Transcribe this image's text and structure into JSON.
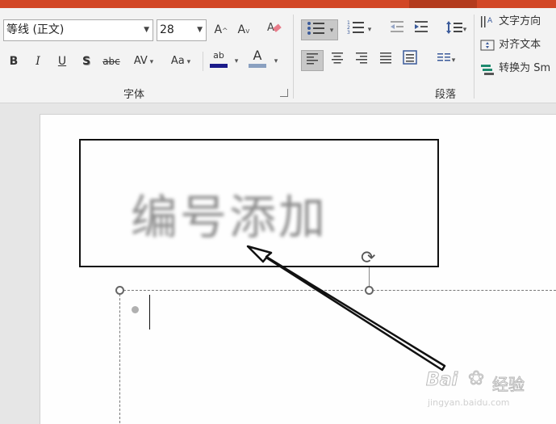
{
  "ribbon": {
    "font_group": {
      "font_name": "等线 (正文)",
      "font_size": "28",
      "grow_font": "A",
      "shrink_font": "A",
      "bold": "B",
      "italic": "I",
      "underline": "U",
      "shadow": "S",
      "strikethrough": "abc",
      "char_spacing": "AV",
      "change_case": "Aa",
      "highlight": "ab",
      "font_color": "A",
      "label": "字体"
    },
    "paragraph_group": {
      "label": "段落"
    },
    "text_group": {
      "text_direction": "文字方向",
      "align_text": "对齐文本",
      "convert_smartart": "转换为 Sm"
    }
  },
  "slide": {
    "textbox_text": "编号添加"
  },
  "watermark": {
    "brand": "Bai",
    "brand_cn": "经验",
    "url": "jingyan.baidu.com"
  },
  "colors": {
    "titlebar": "#d24726",
    "highlight_bar": "#1b1b8a",
    "font_color_bar": "#8aa0c0"
  }
}
